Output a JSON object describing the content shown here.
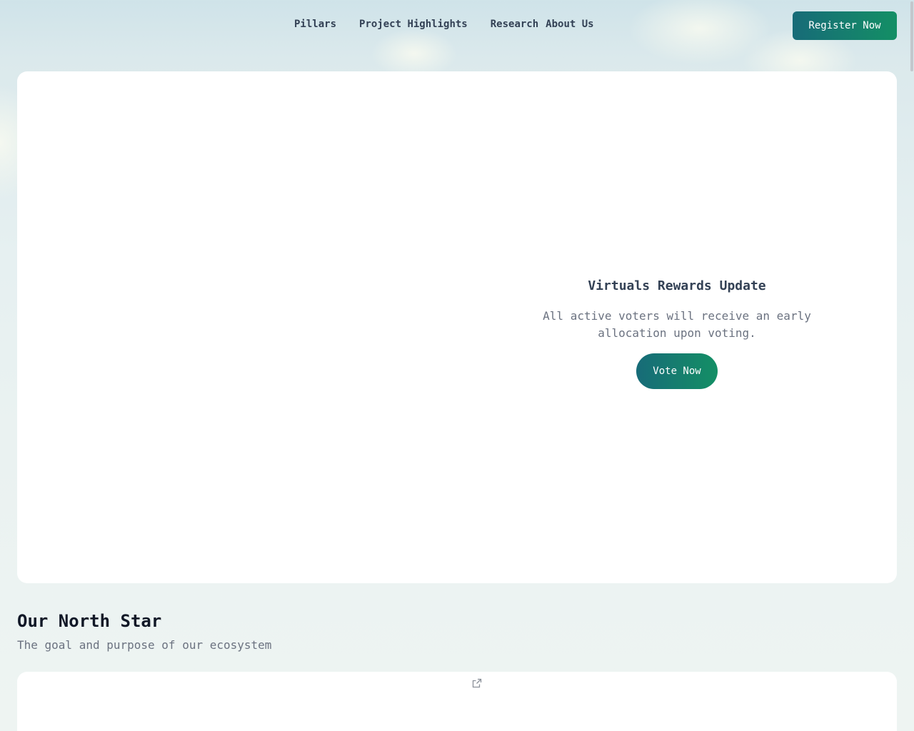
{
  "nav": {
    "links": [
      "Pillars",
      "Project Highlights",
      "Research",
      "About Us"
    ],
    "register_label": "Register Now"
  },
  "hero": {
    "title": "Virtuals Rewards Update",
    "description": "All active voters will receive an early allocation upon voting.",
    "vote_label": "Vote Now"
  },
  "north_star": {
    "title": "Our North Star",
    "subtitle": "The goal and purpose of our ecosystem",
    "link_icon": "external-link-icon"
  },
  "colors": {
    "accent_start": "#176b78",
    "accent_end": "#148f65"
  }
}
